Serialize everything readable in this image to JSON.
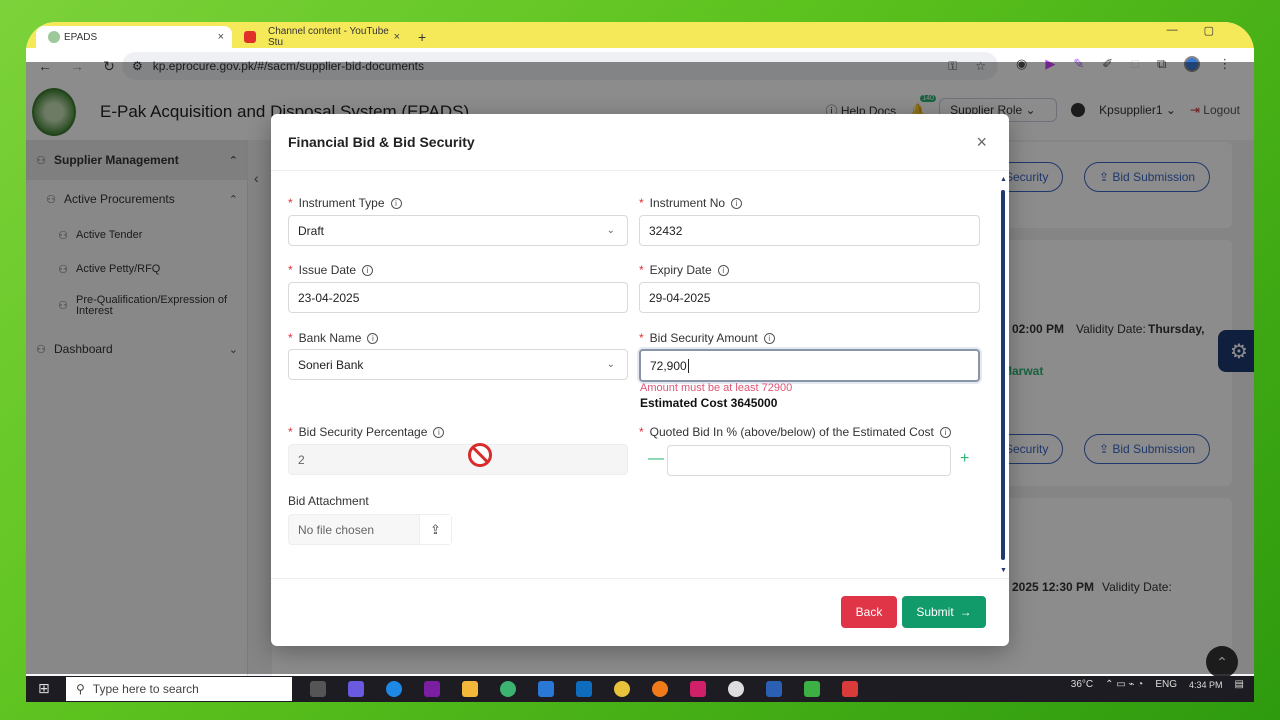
{
  "browser": {
    "tabs": [
      {
        "title": "EPADS",
        "close": "×",
        "active": true
      },
      {
        "title": "Channel content - YouTube Stu",
        "close": "×",
        "active": false
      }
    ],
    "new_tab": "+",
    "url": "kp.eprocure.gov.pk/#/sacm/supplier-bid-documents"
  },
  "header": {
    "title": "E-Pak Acquisition and Disposal System (EPADS)",
    "help": "Help Docs",
    "notif_count": "140",
    "role": "Supplier Role",
    "user": "Kpsupplier1",
    "logout": "Logout"
  },
  "sidebar": {
    "items": [
      {
        "label": "Supplier Management"
      },
      {
        "label": "Active Procurements"
      },
      {
        "label": "Active Tender"
      },
      {
        "label": "Active Petty/RFQ"
      },
      {
        "label": "Pre-Qualification/Expression of Interest"
      },
      {
        "label": "Dashboard"
      }
    ]
  },
  "background": {
    "bid_security": "d Security",
    "bid_submission": "Bid Submission",
    "row1_text": "02:00 PM",
    "row1_validity": "Validity Date:",
    "row1_validity_val": "Thursday,",
    "row1_green": "Marwat",
    "row2_text": "2025 12:30 PM",
    "row2_validity": "Validity Date:"
  },
  "modal": {
    "title": "Financial Bid & Bid Security",
    "close": "×",
    "fields": {
      "instrument_type": {
        "label": "Instrument Type",
        "value": "Draft"
      },
      "instrument_no": {
        "label": "Instrument No",
        "value": "32432"
      },
      "issue_date": {
        "label": "Issue Date",
        "value": "23-04-2025"
      },
      "expiry_date": {
        "label": "Expiry Date",
        "value": "29-04-2025"
      },
      "bank_name": {
        "label": "Bank Name",
        "value": "Soneri Bank"
      },
      "bid_security_amount": {
        "label": "Bid Security Amount",
        "value": "72,900"
      },
      "bid_security_percentage": {
        "label": "Bid Security Percentage",
        "value": "2"
      },
      "quoted_bid": {
        "label": "Quoted Bid In % (above/below) of the Estimated Cost",
        "value": ""
      }
    },
    "error": "Amount must be at least 72900",
    "estimated_cost": "Estimated Cost 3645000",
    "attachment": {
      "label": "Bid Attachment",
      "placeholder": "No file chosen"
    },
    "back": "Back",
    "submit": "Submit"
  },
  "taskbar": {
    "search": "Type here to search",
    "weather": "36°C",
    "lang": "ENG",
    "time": "4:34 PM"
  }
}
